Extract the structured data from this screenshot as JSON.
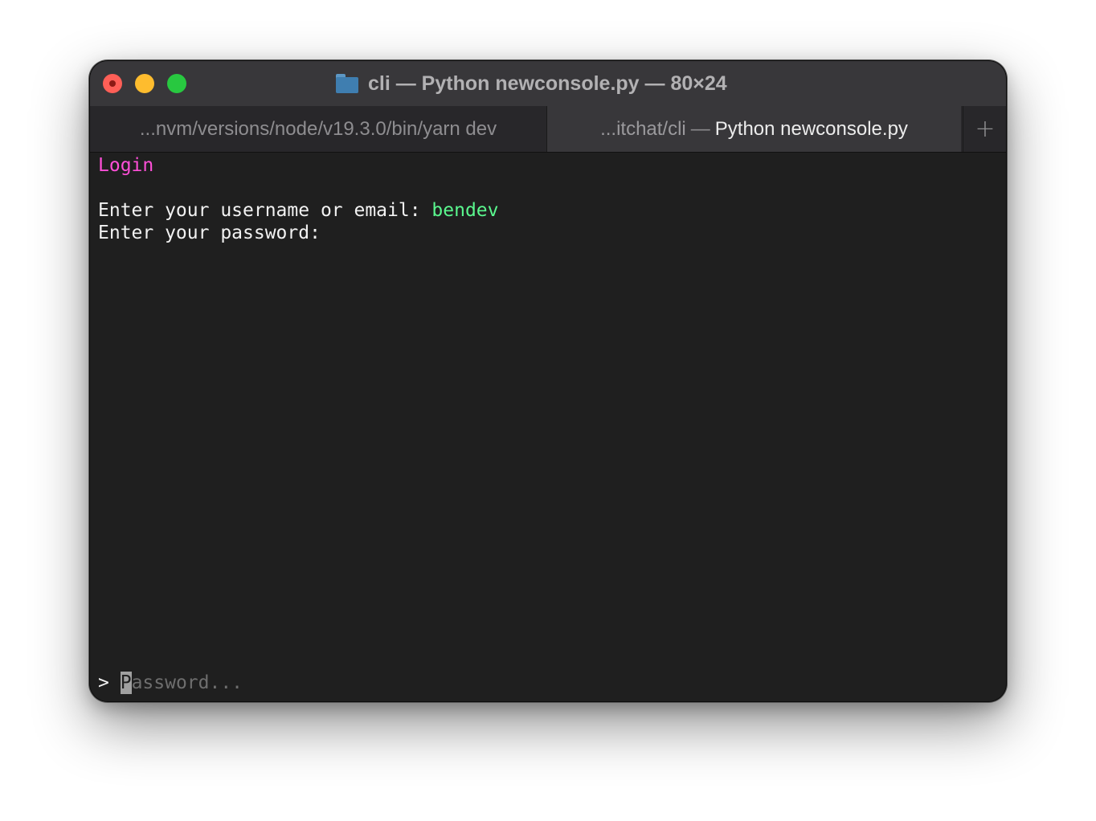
{
  "window": {
    "title": "cli — Python newconsole.py — 80×24",
    "folder_icon": "folder-icon"
  },
  "tabs": [
    {
      "label": "...nvm/versions/node/v19.3.0/bin/yarn dev",
      "active": false
    },
    {
      "path": "...itchat/cli",
      "separator": "—",
      "process": "Python newconsole.py",
      "active": true
    }
  ],
  "new_tab_icon": "plus-icon",
  "terminal": {
    "heading": "Login",
    "username_prompt": "Enter your username or email: ",
    "username_value": "bendev",
    "password_prompt": "Enter your password:",
    "input_prompt": "> ",
    "input_placeholder_first": "P",
    "input_placeholder_rest": "assword..."
  },
  "colors": {
    "close": "#ff5f57",
    "minimize": "#febc2e",
    "maximize": "#28c840",
    "heading": "#ff4fd8",
    "username_value": "#5af78e",
    "background": "#1f1f1f"
  }
}
